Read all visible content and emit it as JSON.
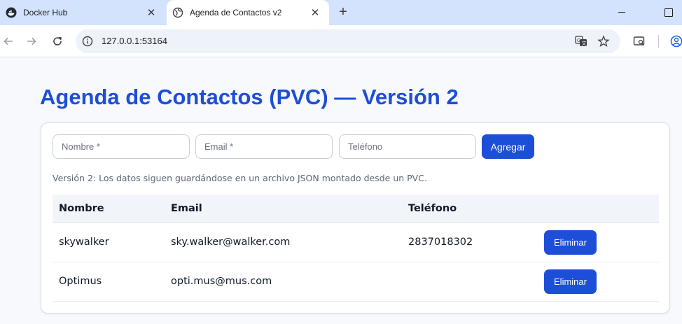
{
  "browser": {
    "tabs": [
      {
        "title": "Docker Hub",
        "icon": "docker-icon",
        "active": false
      },
      {
        "title": "Agenda de Contactos v2",
        "icon": "globe-icon",
        "active": true
      }
    ],
    "url": "127.0.0.1:53164"
  },
  "page": {
    "title": "Agenda de Contactos (PVC) — Versión 2",
    "form": {
      "name_placeholder": "Nombre *",
      "email_placeholder": "Email *",
      "phone_placeholder": "Teléfono",
      "add_label": "Agregar"
    },
    "note": "Versión 2: Los datos siguen guardándose en un archivo JSON montado desde un PVC.",
    "table": {
      "headers": [
        "Nombre",
        "Email",
        "Teléfono"
      ],
      "rows": [
        {
          "name": "skywalker",
          "email": "sky.walker@walker.com",
          "phone": "2837018302",
          "action": "Eliminar"
        },
        {
          "name": "Optimus",
          "email": "opti.mus@mus.com",
          "phone": "",
          "action": "Eliminar"
        }
      ]
    },
    "colors": {
      "accent": "#1d4ed8",
      "background": "#f7f9fc"
    }
  }
}
